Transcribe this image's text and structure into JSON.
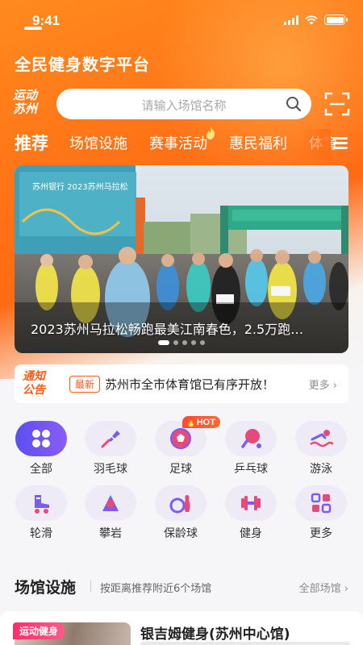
{
  "status": {
    "time": "9:41"
  },
  "app": {
    "title": "全民健身数字平台",
    "logo_line1": "运动",
    "logo_line2": "苏州"
  },
  "search": {
    "placeholder": "请输入场馆名称"
  },
  "tabs": [
    {
      "label": "推荐",
      "active": true
    },
    {
      "label": "场馆设施"
    },
    {
      "label": "赛事活动",
      "hot": true
    },
    {
      "label": "惠民福利"
    },
    {
      "label": "体育"
    }
  ],
  "banner": {
    "caption": "2023苏州马拉松畅跑最美江南春色，2.5万跑…",
    "arch_text": "苏州银行 2023苏州马拉松",
    "slide_count": 5,
    "active_slide": 1
  },
  "notice": {
    "logo_line1": "通知",
    "logo_line2": "公告",
    "badge": "最新",
    "text": "苏州市全市体育馆已有序开放！",
    "more": "更多"
  },
  "categories": [
    {
      "label": "全部",
      "icon": "grid-all-icon"
    },
    {
      "label": "羽毛球",
      "icon": "badminton-icon"
    },
    {
      "label": "足球",
      "icon": "football-icon",
      "badge": "HOT"
    },
    {
      "label": "乒乓球",
      "icon": "pingpong-icon"
    },
    {
      "label": "游泳",
      "icon": "swim-icon"
    },
    {
      "label": "轮滑",
      "icon": "roller-skate-icon"
    },
    {
      "label": "攀岩",
      "icon": "climbing-icon"
    },
    {
      "label": "保龄球",
      "icon": "bowling-icon"
    },
    {
      "label": "健身",
      "icon": "dumbbell-icon"
    },
    {
      "label": "更多",
      "icon": "more-apps-icon"
    }
  ],
  "venues_section": {
    "title": "场馆设施",
    "subtitle": "按距离推荐附近6个场馆",
    "all": "全部场馆"
  },
  "venue": {
    "tag": "运动健身",
    "name": "银吉姆健身(苏州中心馆)"
  },
  "colors": {
    "brand_orange": "#ff6a14",
    "accent_purple": "#6b55f2",
    "hot_red": "#ff4a3a",
    "tag_pink": "#ff2f6a"
  }
}
